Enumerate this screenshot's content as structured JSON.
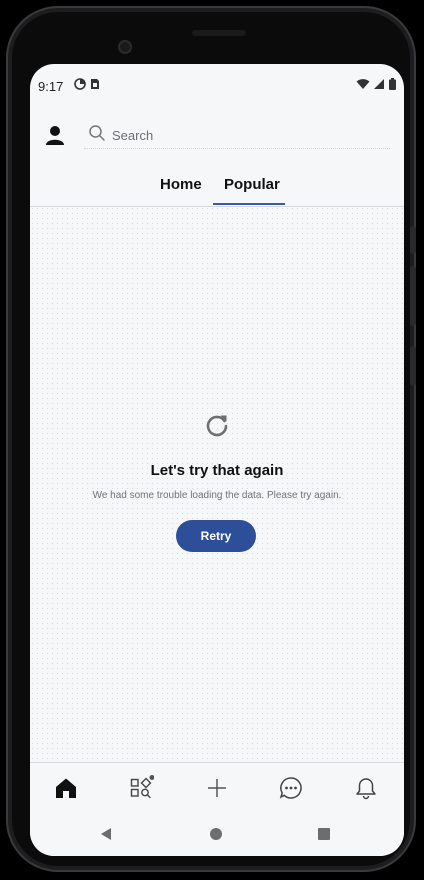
{
  "status": {
    "time": "9:17"
  },
  "header": {
    "search_placeholder": "Search"
  },
  "tabs": [
    {
      "label": "Home",
      "selected": false
    },
    {
      "label": "Popular",
      "selected": true
    }
  ],
  "error": {
    "title": "Let's try that again",
    "message": "We had some trouble loading the data. Please try again.",
    "retry_label": "Retry"
  },
  "bottom_nav": [
    {
      "icon": "home-icon",
      "active": true
    },
    {
      "icon": "discover-icon",
      "badge": true
    },
    {
      "icon": "plus-icon"
    },
    {
      "icon": "chat-icon"
    },
    {
      "icon": "bell-icon"
    }
  ],
  "system_nav": [
    "back-icon",
    "home-circle-icon",
    "recents-icon"
  ],
  "colors": {
    "accent": "#2d4f9a",
    "tab_indicator": "#3a5aa8",
    "background": "#f6f7f9",
    "frame": "#1d1d1f"
  }
}
